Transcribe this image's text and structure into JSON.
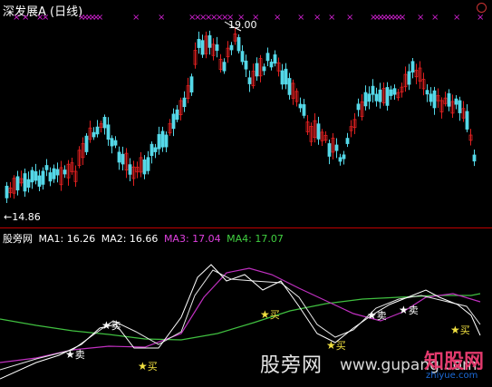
{
  "price_panel": {
    "title": "深发展A (日线)",
    "high_label": "19.00",
    "low_label": "←14.86"
  },
  "indicator_panel": {
    "name": "股旁网",
    "ma1": "MA1: 16.26",
    "ma2": "MA2: 16.66",
    "ma3": "MA3: 17.04",
    "ma4": "MA4: 17.07",
    "colors": {
      "ma1": "#ffffff",
      "ma2": "#ffffff",
      "ma3": "#e040e0",
      "ma4": "#40d040"
    }
  },
  "signals": [
    {
      "type": "sell",
      "label": "卖",
      "color": "#ffffff"
    },
    {
      "type": "sell",
      "label": "卖",
      "color": "#ffffff"
    },
    {
      "type": "buy",
      "label": "买",
      "color": "#f0e040"
    },
    {
      "type": "buy",
      "label": "买",
      "color": "#f0e040"
    },
    {
      "type": "buy",
      "label": "买",
      "color": "#f0e040"
    },
    {
      "type": "sell",
      "label": "卖",
      "color": "#ffffff"
    },
    {
      "type": "sell",
      "label": "卖",
      "color": "#ffffff"
    },
    {
      "type": "buy",
      "label": "买",
      "color": "#f0e040"
    }
  ],
  "watermark": {
    "site_cn": "股旁网",
    "url": "www.gupang.com",
    "logo_text": "知股网",
    "logo_url": "zhiyue.com"
  },
  "colors": {
    "up": "#e02020",
    "down": "#54d8e8",
    "marker": "#d020d0",
    "separator": "#c00000"
  }
}
